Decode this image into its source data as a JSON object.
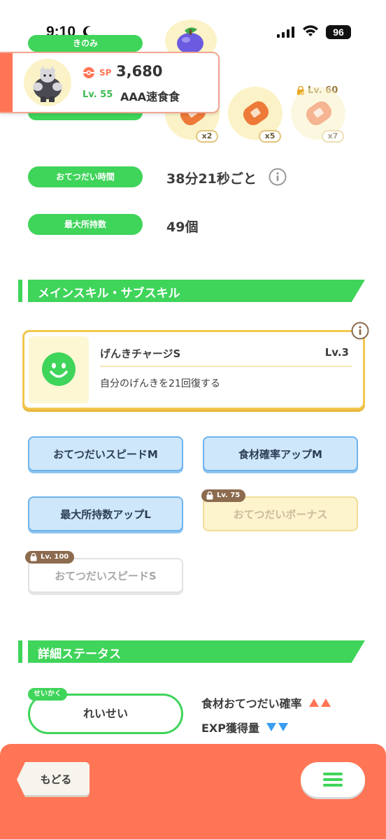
{
  "status_bar": {
    "time": "9:10",
    "battery": "96"
  },
  "top_labels": {
    "berry_label": "きのみ"
  },
  "ingredients": [
    {
      "count": "x2",
      "locked": false
    },
    {
      "count": "x5",
      "locked": false
    },
    {
      "count": "x7",
      "locked": true,
      "unlock_level": "Lv. 60"
    }
  ],
  "profile": {
    "sp_label": "SP",
    "sp_value": "3,680",
    "level": "Lv. 55",
    "ranking": "AAA速食食"
  },
  "stats": [
    {
      "label": "おてつだい時間",
      "value": "38分21秒ごと"
    },
    {
      "label": "最大所持数",
      "value": "49個"
    }
  ],
  "sections": {
    "skills": "メインスキル・サブスキル",
    "details": "詳細ステータス"
  },
  "main_skill": {
    "name": "げんきチャージS",
    "level": "Lv.3",
    "description": "自分のげんきを21回復する"
  },
  "sub_skills": [
    {
      "label": "おてつだいスピードM"
    },
    {
      "label": "食材確率アップM"
    },
    {
      "label": "最大所持数アップL"
    },
    {
      "label": "おてつだいボーナス",
      "lock_level": "Lv. 75"
    },
    {
      "label": "おてつだいスピードS",
      "lock_level": "Lv. 100"
    }
  ],
  "nature": {
    "tag": "せいかく",
    "value": "れいせい",
    "up_effect": "食材おてつだい確率",
    "down_effect": "EXP獲得量"
  },
  "bottom": {
    "back_label": "もどる"
  },
  "colors": {
    "accent_green": "#3fd45a",
    "accent_orange": "#ff7556",
    "up_arrow": "#ff7556",
    "down_arrow": "#3a9df0"
  }
}
